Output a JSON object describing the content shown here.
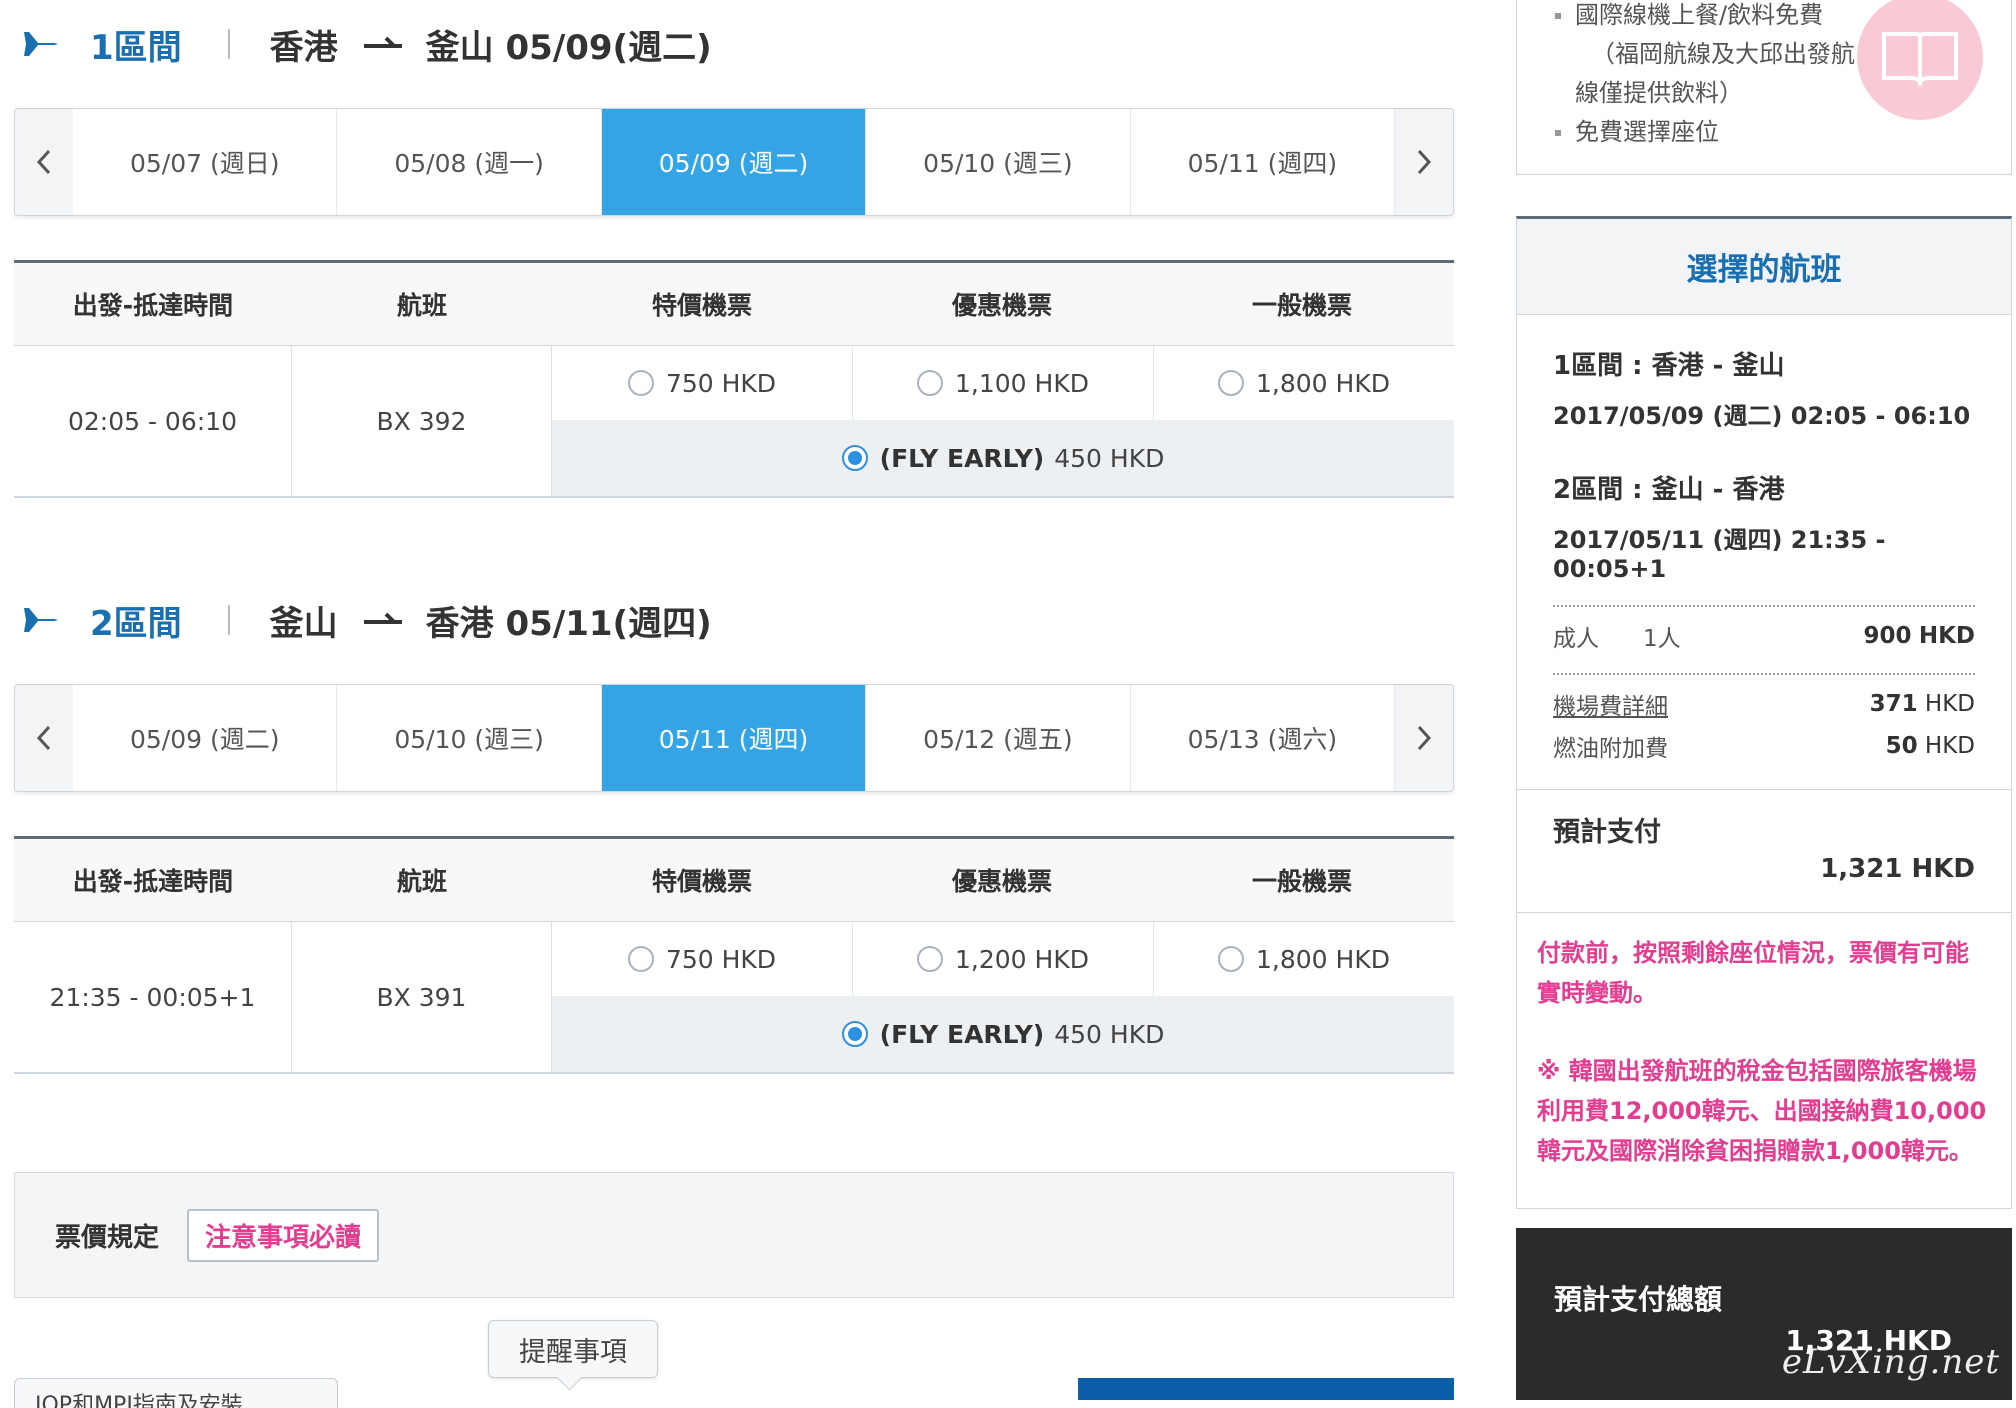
{
  "segment1": {
    "header": {
      "number": "1區間",
      "from": "香港",
      "to_date": "釜山 05/09(週二)"
    },
    "dates": [
      "05/07 (週日)",
      "05/08 (週一)",
      "05/09 (週二)",
      "05/10 (週三)",
      "05/11 (週四)"
    ],
    "active_date_index": 2,
    "columns": [
      "出發-抵達時間",
      "航班",
      "特價機票",
      "優惠機票",
      "一般機票"
    ],
    "time": "02:05 - 06:10",
    "flight": "BX 392",
    "fares": [
      "750 HKD",
      "1,100 HKD",
      "1,800 HKD"
    ],
    "fly_early": {
      "tag": "(FLY EARLY)",
      "price": "450 HKD"
    }
  },
  "segment2": {
    "header": {
      "number": "2區間",
      "from": "釜山",
      "to_date": "香港 05/11(週四)"
    },
    "dates": [
      "05/09 (週二)",
      "05/10 (週三)",
      "05/11 (週四)",
      "05/12 (週五)",
      "05/13 (週六)"
    ],
    "active_date_index": 2,
    "columns": [
      "出發-抵達時間",
      "航班",
      "特價機票",
      "優惠機票",
      "一般機票"
    ],
    "time": "21:35 - 00:05+1",
    "flight": "BX 391",
    "fares": [
      "750 HKD",
      "1,200 HKD",
      "1,800 HKD"
    ],
    "fly_early": {
      "tag": "(FLY EARLY)",
      "price": "450 HKD"
    }
  },
  "fare_rules": {
    "label": "票價規定",
    "button": "注意事項必讀"
  },
  "tips_button": "提醒事項",
  "bottom_tab": "JOP和MPI指南及安裝",
  "benefits": {
    "item1": "國際線機上餐/飲料免費",
    "item1_sub1": "（福岡航線及大邱出發航",
    "item1_sub2": "線僅提供飲料）",
    "item2": "免費選擇座位"
  },
  "summary": {
    "title": "選擇的航班",
    "seg1_title": "1區間 : 香港 - 釜山",
    "seg1_detail": "2017/05/09 (週二) 02:05 - 06:10",
    "seg2_title": "2區間 : 釜山 - 香港",
    "seg2_detail": "2017/05/11 (週四) 21:35 - 00:05+1",
    "adult_label": "成人",
    "adult_count": "1人",
    "adult_amount": "900",
    "airport_fee_label": "機場費詳細",
    "airport_fee_amount": "371",
    "fuel_label": "燃油附加費",
    "fuel_amount": "50",
    "currency": "HKD",
    "estimate_label": "預計支付",
    "estimate_value": "1,321 HKD",
    "note1": "付款前，按照剩餘座位情況，票價有可能實時變動。",
    "note2": "※ 韓國出發航班的稅金包括國際旅客機場利用費12,000韓元、出國接納費10,000韓元及國際消除貧困捐贈款1,000韓元。"
  },
  "total": {
    "label": "預計支付總額",
    "value": "1,321 HKD"
  },
  "watermark": "eLvXing.net",
  "colors": {
    "accent_blue": "#35a4e5",
    "brand_blue": "#1a6fb0",
    "notice_pink": "#e33d92",
    "total_bg": "#2b2b2b"
  }
}
